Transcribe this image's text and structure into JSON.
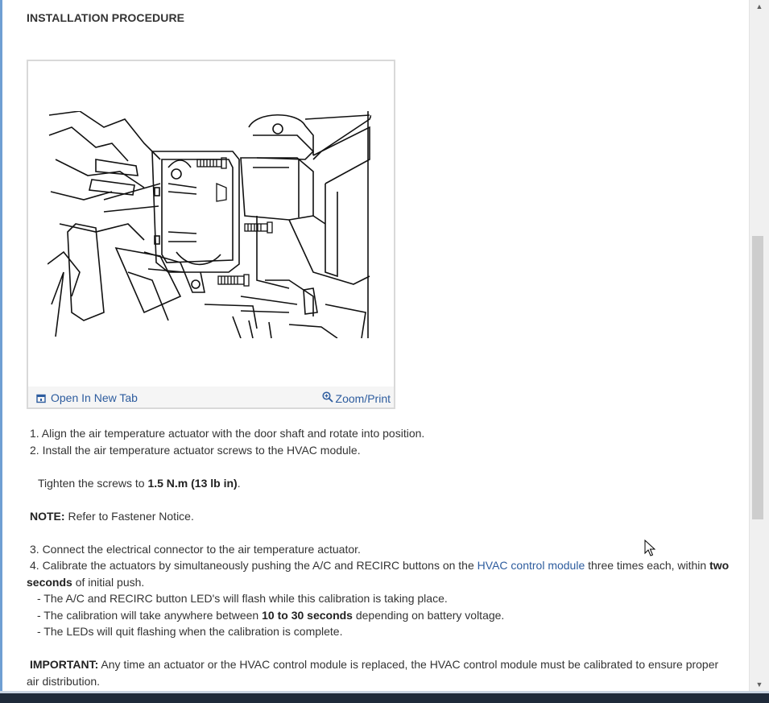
{
  "heading": "INSTALLATION PROCEDURE",
  "figure": {
    "open_label": "Open In New Tab",
    "zoom_label": "Zoom/Print",
    "open_icon": "open-new-tab-icon",
    "zoom_icon": "zoom-magnifier-icon"
  },
  "steps": {
    "s1": "1. Align the air temperature actuator with the door shaft and rotate into position.",
    "s2": "2. Install the air temperature actuator screws to the HVAC module.",
    "tighten_pre": "Tighten the screws to ",
    "tighten_value": "1.5 N.m (13 lb in)",
    "tighten_post": ".",
    "note_label": "NOTE:",
    "note_text": " Refer to Fastener Notice.",
    "s3": "3. Connect the electrical connector to the air temperature actuator.",
    "s4_pre": "4. Calibrate the actuators by simultaneously pushing the A/C and RECIRC buttons on the ",
    "s4_link": "HVAC control module",
    "s4_mid": " three times each, within ",
    "s4_bold1": "two",
    "s4_bold2": "seconds",
    "s4_post": " of initial push.",
    "b1": "-  The A/C and RECIRC button LED's will flash while this calibration is taking place.",
    "b2_pre": "-  The calibration will take anywhere between ",
    "b2_bold": "10 to 30 seconds",
    "b2_post": " depending on battery voltage.",
    "b3": "-  The LEDs will quit flashing when the calibration is complete.",
    "important_label": "IMPORTANT:",
    "important_text1": " Any time an actuator or the HVAC control module is replaced, the HVAC control module must be calibrated to ensure proper",
    "important_text2": "air distribution."
  },
  "colors": {
    "link": "#2d5c9e",
    "text": "#333333",
    "figure_border": "#d9d9d9",
    "figure_bar": "#f5f5f5"
  }
}
